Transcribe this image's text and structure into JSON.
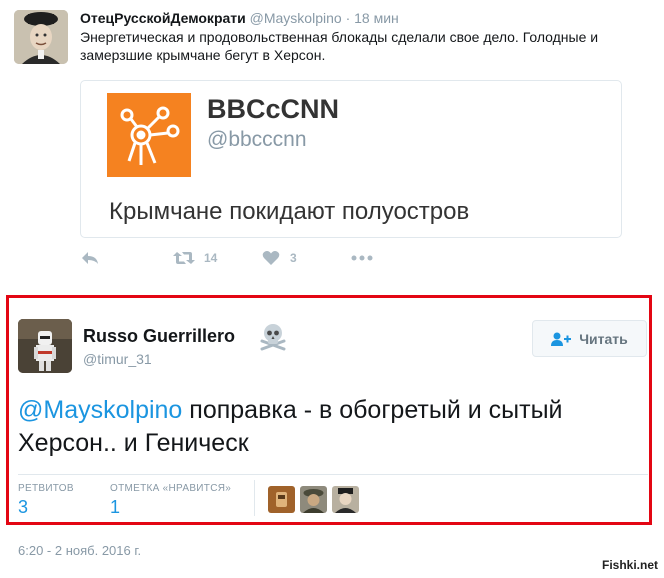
{
  "tweet1": {
    "author_name": "ОтецРусскойДемократи",
    "author_handle": "@Mayskolpino",
    "dot": "·",
    "time": "18 мин",
    "text": "Энергетическая и продовольственная блокады сделали свое дело. Голодные и замерзшие крымчане бегут в Херсон.",
    "quoted": {
      "name": "BBCcCNN",
      "handle": "@bbcccnn",
      "text": "Крымчане покидают полуостров",
      "logo_color": "#f58220"
    },
    "actions": {
      "retweet_count": "14",
      "like_count": "3"
    }
  },
  "tweet2": {
    "author_name": "Russo Guerrillero",
    "author_handle": "@timur_31",
    "follow_label": "Читать",
    "mention": "@Mayskolpino",
    "text_rest": " поправка - в обогретый и сытый Херсон..  и Геническ",
    "retweets_label": "РЕТВИТОВ",
    "retweets_value": "3",
    "likes_label": "ОТМЕТКА «НРАВИТСЯ»",
    "likes_value": "1",
    "timestamp": "6:20 - 2 нояб. 2016 г."
  },
  "watermark": "Fishki.net",
  "colors": {
    "highlight_frame": "#e30613",
    "link": "#1b95e0",
    "muted": "#8899a6",
    "icon": "#aab8c2"
  }
}
